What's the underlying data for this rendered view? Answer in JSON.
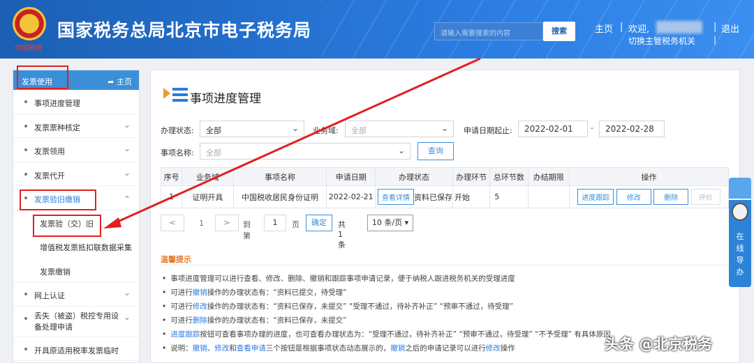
{
  "header": {
    "site_title": "国家税务总局北京市电子税务局",
    "emblem_text": "中国税务",
    "search_placeholder": "请输入需要搜索的内容",
    "search_button": "搜索",
    "home_link": "主页",
    "welcome": "欢迎,",
    "logout": "退出",
    "switch_org": "切换主管税务机关",
    "separator": "|"
  },
  "sidebar": {
    "section_title": "发票使用",
    "home_label": "主页",
    "items": [
      {
        "label": "事项进度管理"
      },
      {
        "label": "发票票种核定"
      },
      {
        "label": "发票领用"
      },
      {
        "label": "发票代开"
      },
      {
        "label": "发票验旧缴销"
      }
    ],
    "subitems": [
      {
        "label": "发票验（交）旧"
      },
      {
        "label": "增值税发票抵扣联数据采集"
      },
      {
        "label": "发票缴销"
      }
    ],
    "items_after": [
      {
        "label": "网上认证"
      },
      {
        "label": "丢失（被盗）税控专用设备处理申请"
      },
      {
        "label": "开具原适用税率发票临时"
      }
    ]
  },
  "main": {
    "title": "事项进度管理",
    "filters": {
      "status_label": "办理状态:",
      "status_value": "全部",
      "business_label": "业务域:",
      "business_placeholder": "全部",
      "date_label": "申请日期起止:",
      "date_start": "2022-02-01",
      "date_sep": "-",
      "date_end": "2022-02-28",
      "item_label": "事项名称:",
      "item_placeholder": "全部",
      "query_button": "查询"
    },
    "table": {
      "headers": [
        "序号",
        "业务域",
        "事项名称",
        "申请日期",
        "办理状态",
        "办理环节",
        "总环节数",
        "办结期限",
        "操作"
      ],
      "rows": [
        {
          "index": "1",
          "domain": "证明开具",
          "name": "中国税收居民身份证明",
          "date": "2022-02-21",
          "status_btn": "查看详情",
          "status": "资料已保存",
          "step": "开始",
          "total": "5",
          "deadline": "",
          "actions": [
            "进度跟踪",
            "修改",
            "删除",
            "评价"
          ]
        }
      ]
    },
    "pager": {
      "prev": "<",
      "current": "1",
      "next": ">",
      "goto_label": "到第",
      "goto_value": "1",
      "page_unit": "页",
      "confirm": "确定",
      "total": "共 1 条",
      "page_size": "10 条/页"
    },
    "tips": {
      "title": "温馨提示",
      "bullet": "•",
      "lines": [
        {
          "text": "事项进度管理可以进行查看、修改、删除、撤销和跟踪事项申请记录，便于纳税人跟进税务机关的受理进度"
        },
        {
          "pre": "可进行",
          "link": "撤销",
          "post": "操作的办理状态有：“资料已提交，待受理”"
        },
        {
          "pre": "可进行",
          "link": "修改",
          "post": "操作的办理状态有：“资料已保存，未提交” “受理不通过，待补齐补正” “预审不通过，待受理”"
        },
        {
          "pre": "可进行",
          "link": "删除",
          "post": "操作的办理状态有：“资料已保存，未提交”"
        },
        {
          "pre": "",
          "link": "进度跟踪",
          "post": "按钮可查看事项办理的进度，也可查看办理状态为：“受理不通过，待补齐补正” “预审不通过，待受理” “不予受理” 有具体原因"
        },
        {
          "pre": "说明：",
          "link": "撤销",
          "mid1": "、",
          "link2": "修改",
          "mid2": "和",
          "link3": "查看申请",
          "mid3": "三个按钮是根据事项状态动态展示的，",
          "link4": "撤销",
          "mid4": "之后的申请记录可以进行",
          "link5": "修改",
          "post": "操作"
        }
      ]
    }
  },
  "float_widget": {
    "text": "在线导办"
  },
  "watermark": "头条 @北京税务",
  "colors": {
    "header_blue": "#2a7be0",
    "accent": "#3b8fd9",
    "highlight": "#e02020",
    "tips_orange": "#e8772b"
  }
}
